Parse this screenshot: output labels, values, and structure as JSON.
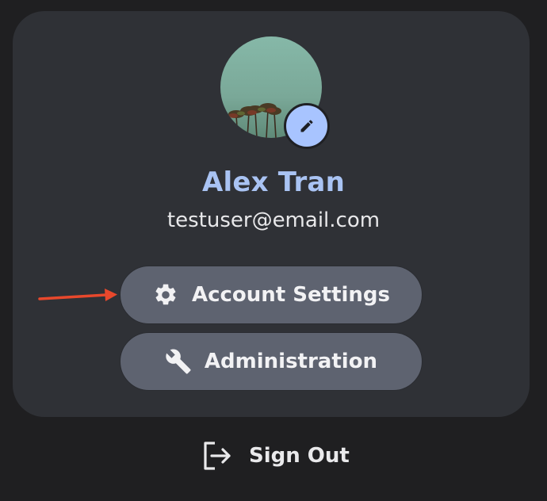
{
  "profile": {
    "name": "Alex Tran",
    "email": "testuser@email.com",
    "avatar_icon": "palm-trees-photo",
    "edit_icon": "pencil-icon"
  },
  "actions": {
    "account_settings": {
      "label": "Account Settings",
      "icon": "gear-icon"
    },
    "administration": {
      "label": "Administration",
      "icon": "wrench-icon"
    },
    "sign_out": {
      "label": "Sign Out",
      "icon": "logout-icon"
    }
  },
  "colors": {
    "name": "#a9c3f3",
    "card": "#2f3136",
    "button": "#5e6370",
    "edit_badge": "#a8c4ff",
    "annotation_arrow": "#e8482c"
  }
}
